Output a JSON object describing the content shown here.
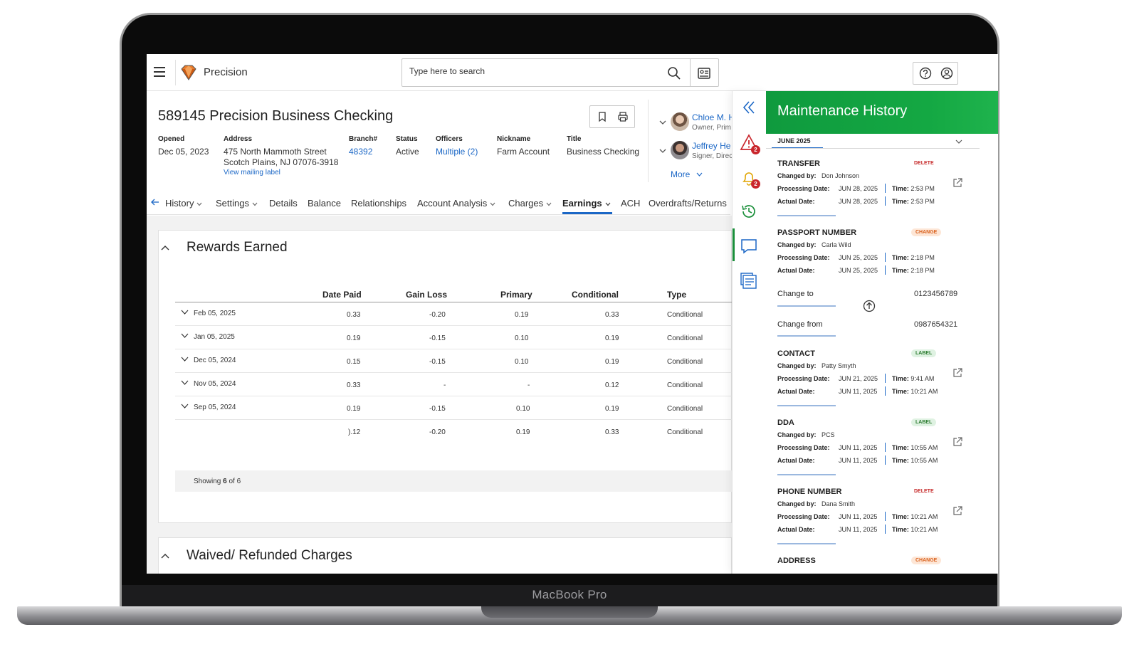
{
  "device": {
    "brand_label": "MacBook Pro"
  },
  "app": {
    "title": "Precision",
    "search": {
      "placeholder": "Type here to search"
    }
  },
  "account": {
    "title": "589145 Precision Business Checking",
    "fields": {
      "opened": {
        "label": "Opened",
        "value": "Dec 05, 2023"
      },
      "address": {
        "label": "Address",
        "line1": "475 North Mammoth Street",
        "line2": "Scotch Plains, NJ 07076-3918",
        "link": "View mailing label"
      },
      "branch": {
        "label": "Branch#",
        "value": "48392"
      },
      "status": {
        "label": "Status",
        "value": "Active"
      },
      "officers": {
        "label": "Officers",
        "value": "Multiple (2)"
      },
      "nickname": {
        "label": "Nickname",
        "value": "Farm Account"
      },
      "title": {
        "label": "Title",
        "value": "Business Checking"
      }
    },
    "contacts": [
      {
        "name": "Chloe M. H",
        "role": "Owner, Prim"
      },
      {
        "name": "Jeffrey He",
        "role": "Signer, Direc"
      }
    ],
    "more_label": "More"
  },
  "tabs": [
    {
      "label": "History",
      "has_menu": true
    },
    {
      "label": "Settings",
      "has_menu": true
    },
    {
      "label": "Details",
      "has_menu": false
    },
    {
      "label": "Balance",
      "has_menu": false
    },
    {
      "label": "Relationships",
      "has_menu": false
    },
    {
      "label": "Account Analysis",
      "has_menu": true
    },
    {
      "label": "Charges",
      "has_menu": true
    },
    {
      "label": "Earnings",
      "has_menu": true,
      "active": true
    },
    {
      "label": "ACH",
      "has_menu": false
    },
    {
      "label": "Overdrafts/Returns",
      "has_menu": false
    }
  ],
  "rewards": {
    "title": "Rewards Earned",
    "columns": [
      "Date Paid",
      "Gain Loss",
      "Primary",
      "Conditional",
      "Type"
    ],
    "rows": [
      {
        "date": "Feb 05, 2025",
        "date_paid": "0.33",
        "gain_loss": "-0.20",
        "primary": "0.19",
        "conditional": "0.33",
        "type": "Conditional"
      },
      {
        "date": "Jan 05, 2025",
        "date_paid": "0.19",
        "gain_loss": "-0.15",
        "primary": "0.10",
        "conditional": "0.19",
        "type": "Conditional"
      },
      {
        "date": "Dec 05, 2024",
        "date_paid": "0.15",
        "gain_loss": "-0.15",
        "primary": "0.10",
        "conditional": "0.19",
        "type": "Conditional"
      },
      {
        "date": "Nov 05, 2024",
        "date_paid": "0.33",
        "gain_loss": "-",
        "primary": "-",
        "conditional": "0.12",
        "type": "Conditional"
      },
      {
        "date": "Sep 05, 2024",
        "date_paid": "0.19",
        "gain_loss": "-0.15",
        "primary": "0.10",
        "conditional": "0.19",
        "type": "Conditional"
      },
      {
        "date": "",
        "date_paid": ").12",
        "gain_loss": "-0.20",
        "primary": "0.19",
        "conditional": "0.33",
        "type": "Conditional"
      }
    ],
    "showing_prefix": "Showing ",
    "showing_count": "6",
    "showing_suffix": " of 6"
  },
  "waived": {
    "title": "Waived/ Refunded Charges"
  },
  "rail": {
    "alert_badge": "2",
    "notification_badge": "2"
  },
  "maintenance": {
    "title": "Maintenance History",
    "month": "JUNE 2025",
    "labels": {
      "changed_by": "Changed by:",
      "processing_date": "Processing Date:",
      "actual_date": "Actual Date:",
      "time": "Time:",
      "change_to": "Change to",
      "change_from": "Change from"
    },
    "entries": [
      {
        "title": "TRANSFER",
        "badge": "DELETE",
        "changed_by": "Don Johnson",
        "processing_date": "JUN 28, 2025",
        "processing_time": "2:53 PM",
        "actual_date": "JUN 28, 2025",
        "actual_time": "2:53 PM"
      },
      {
        "title": "PASSPORT NUMBER",
        "badge": "CHANGE",
        "changed_by": "Carla Wild",
        "processing_date": "JUN 25, 2025",
        "processing_time": "2:18 PM",
        "actual_date": "JUN 25, 2025",
        "actual_time": "2:18 PM",
        "change_to": "0123456789",
        "change_from": "0987654321"
      },
      {
        "title": "CONTACT",
        "badge": "LABEL",
        "changed_by": "Patty Smyth",
        "processing_date": "JUN 21, 2025",
        "processing_time": "9:41 AM",
        "actual_date": "JUN 11, 2025",
        "actual_time": "10:21 AM"
      },
      {
        "title": "DDA",
        "badge": "LABEL",
        "changed_by": "PCS",
        "processing_date": "JUN 11, 2025",
        "processing_time": "10:55 AM",
        "actual_date": "JUN 11, 2025",
        "actual_time": "10:55 AM"
      },
      {
        "title": "PHONE NUMBER",
        "badge": "DELETE",
        "changed_by": "Dana Smith",
        "processing_date": "JUN 11, 2025",
        "processing_time": "10:21 AM",
        "actual_date": "JUN 11, 2025",
        "actual_time": "10:21 AM"
      },
      {
        "title": "ADDRESS",
        "badge": "CHANGE"
      }
    ]
  },
  "colors": {
    "accent_blue": "#1b67c6",
    "brand_green": "#14a843",
    "delete_red": "#c62828",
    "change_orange": "#d9601c",
    "label_green": "#2e7d32",
    "badge_red": "#c9262c"
  }
}
